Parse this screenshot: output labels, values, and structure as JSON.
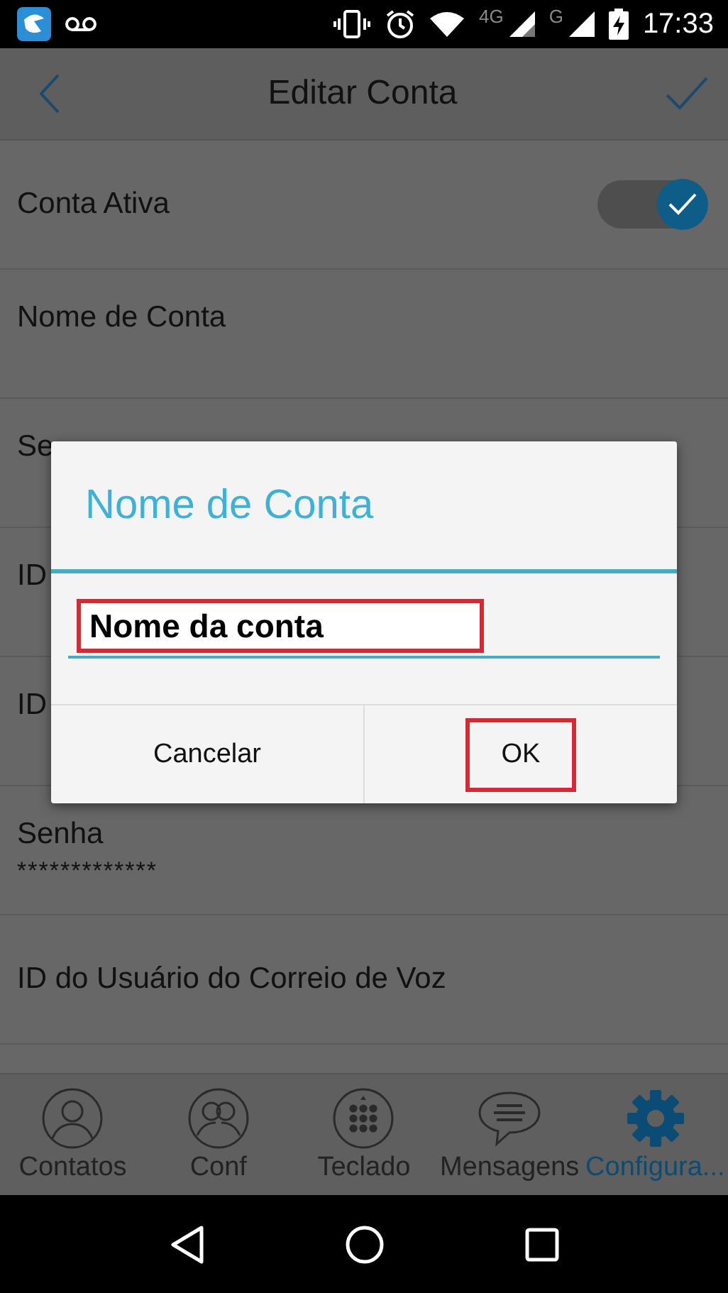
{
  "status_bar": {
    "network_labels": [
      "4G",
      "G"
    ],
    "time": "17:33"
  },
  "app_bar": {
    "title": "Editar Conta"
  },
  "settings": [
    {
      "kind": "toggle",
      "label": "Conta Ativa",
      "checked": true
    },
    {
      "kind": "text",
      "label": "Nome de Conta"
    },
    {
      "kind": "text",
      "label": "Se"
    },
    {
      "kind": "text",
      "label": "ID"
    },
    {
      "kind": "text",
      "label": "ID"
    },
    {
      "kind": "text",
      "label": "Senha",
      "value": "*************"
    },
    {
      "kind": "text",
      "label": "ID do Usuário do Correio de Voz"
    }
  ],
  "dialog": {
    "title": "Nome de Conta",
    "input_value": "Nome da conta",
    "input_highlighted": true,
    "buttons": [
      {
        "label": "Cancelar",
        "highlighted": false
      },
      {
        "label": "OK",
        "highlighted": true
      }
    ]
  },
  "bottom_nav": [
    {
      "label": "Contatos",
      "kind": "person",
      "selected": false
    },
    {
      "label": "Conf",
      "kind": "group",
      "selected": false
    },
    {
      "label": "Teclado",
      "kind": "dialpad",
      "selected": false
    },
    {
      "label": "Mensagens",
      "kind": "chat",
      "selected": false
    },
    {
      "label": "Configura...",
      "kind": "gear",
      "selected": true
    }
  ]
}
